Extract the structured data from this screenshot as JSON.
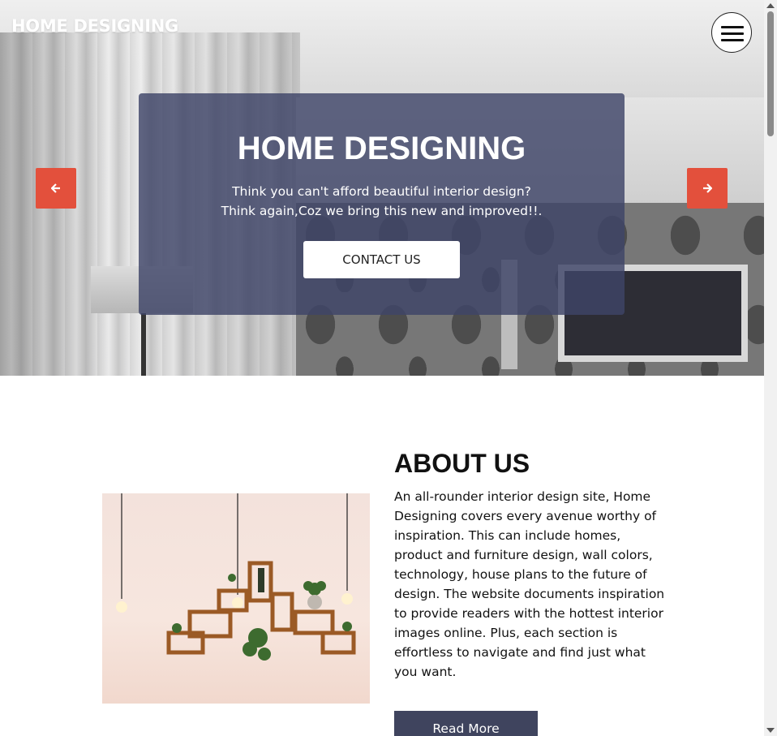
{
  "header": {
    "brand": "HOME DESIGNING",
    "menu_icon": "hamburger-menu-icon"
  },
  "hero": {
    "title": "HOME DESIGNING",
    "subtitle_line1": "Think you can't afford beautiful interior design?",
    "subtitle_line2": "Think again,Coz we bring this new and improved!!.",
    "cta_label": "CONTACT US",
    "prev_icon": "arrow-left-icon",
    "next_icon": "arrow-right-icon",
    "arrow_color": "#e3503c",
    "overlay_color": "#3e4468"
  },
  "about": {
    "title": "ABOUT US",
    "text": "An all-rounder interior design site, Home Designing covers every avenue worthy of inspiration. This can include homes, product and furniture design, wall colors, technology, house plans to the future of design. The website documents inspiration to provide readers with the hottest interior images online. Plus, each section is effortless to navigate and find just what you want.",
    "button_label": "Read More",
    "button_color": "#3f445e"
  }
}
